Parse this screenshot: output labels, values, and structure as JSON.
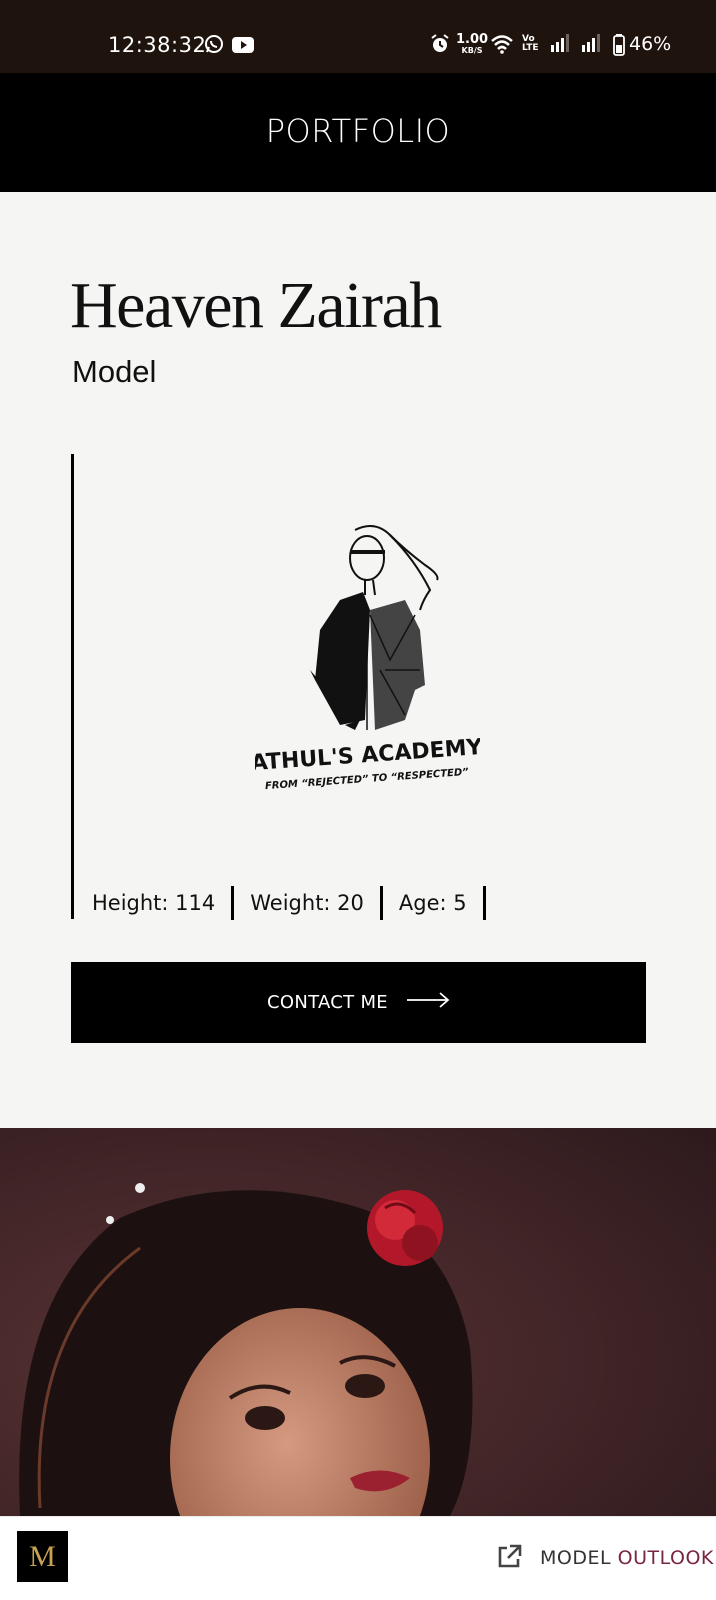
{
  "status_bar": {
    "time": "12:38:32",
    "net_speed_value": "1.00",
    "net_speed_unit": "KB/S",
    "volte_label": "Vo LTE",
    "battery": "46%",
    "icons": [
      "whatsapp-icon",
      "youtube-icon",
      "alarm-icon",
      "wifi-icon",
      "volte-icon",
      "signal-icon",
      "signal-icon",
      "battery-icon"
    ]
  },
  "header": {
    "title": "PORTFOLIO"
  },
  "profile": {
    "name": "Heaven Zairah",
    "role": "Model",
    "logo": {
      "line1": "ATHUL'S ACADEMY",
      "line2": "FROM “REJECTED” TO “RESPECTED”"
    },
    "stats": [
      {
        "label": "Height: 114"
      },
      {
        "label": "Weight: 20"
      },
      {
        "label": "Age: 5"
      }
    ],
    "contact_label": "CONTACT ME"
  },
  "bottom_bar": {
    "brand_part1": "MODEL ",
    "brand_part2": "OUTLOOK",
    "logo_letter": "M",
    "colors": {
      "accent": "#7a2540",
      "gold": "#c8a24e"
    }
  }
}
